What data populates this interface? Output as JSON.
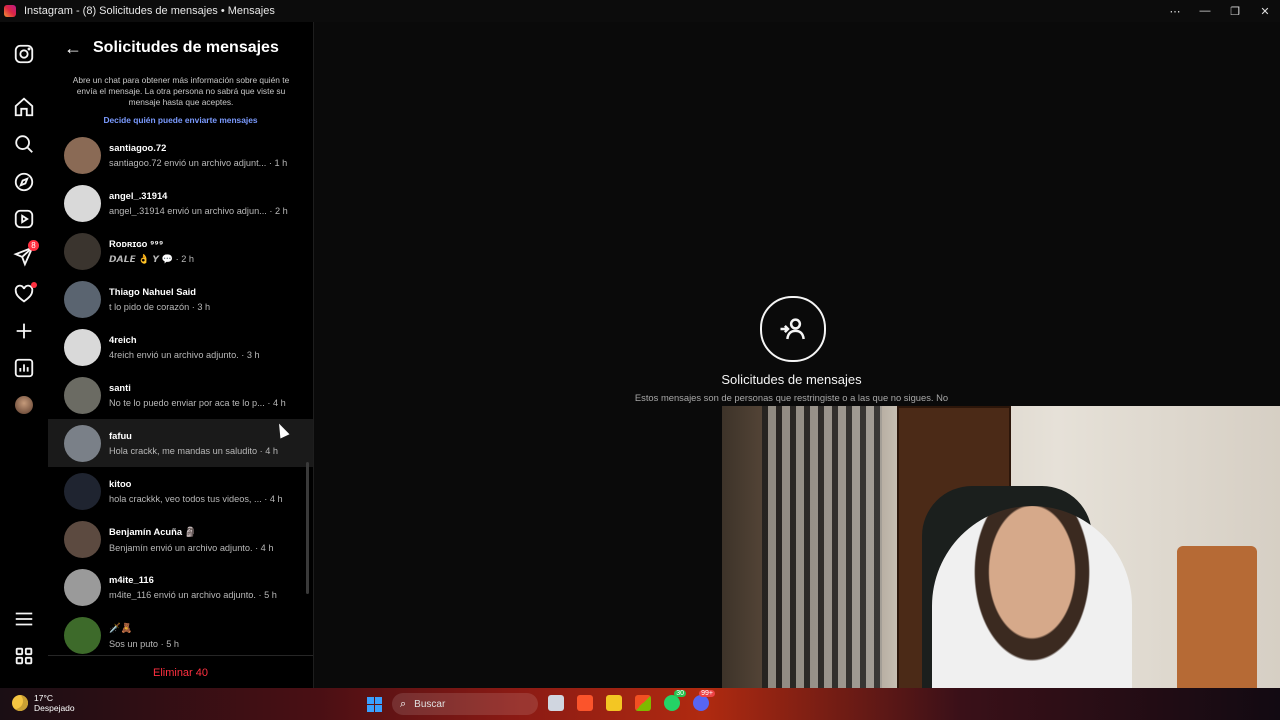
{
  "window": {
    "title": "Instagram - (8) Solicitudes de mensajes • Mensajes",
    "controls": [
      "⋯",
      "—",
      "❐",
      "✕"
    ]
  },
  "rail": {
    "notifications_badge": "8"
  },
  "panel": {
    "title": "Solicitudes de mensajes",
    "info": "Abre un chat para obtener más información sobre quién te envía el mensaje. La otra persona no sabrá que viste su mensaje hasta que aceptes.",
    "link": "Decide quién puede enviarte mensajes",
    "delete_label": "Eliminar 40"
  },
  "requests": [
    {
      "name": "santiagoo.72",
      "preview": "santiagoo.72 envió un archivo adjunt... · 1 h",
      "color": "#8a6a55"
    },
    {
      "name": "angel_.31914",
      "preview": "angel_.31914 envió un archivo adjun... · 2 h",
      "color": "#d9d9d9"
    },
    {
      "name": "Rᴏᴅʀɪɢᴏ  ⁹⁹⁹",
      "preview": "𝘿𝘼𝙇𝙀 👌 𝙔 💬 · 2 h",
      "color": "#3a342e"
    },
    {
      "name": "Thiago Nahuel Said",
      "preview": "t lo pido de corazón · 3 h",
      "color": "#5a6470"
    },
    {
      "name": "4reich",
      "preview": "4reich envió un archivo adjunto. · 3 h",
      "color": "#d9d9d9"
    },
    {
      "name": "santi",
      "preview": "No te lo puedo enviar por aca te lo p... · 4 h",
      "color": "#6b6b63"
    },
    {
      "name": "fafuu",
      "preview": "Hola crackk, me mandas un saludito · 4 h",
      "color": "#7a8088"
    },
    {
      "name": "kitoo",
      "preview": "hola crackkk, veo todos tus videos, ... · 4 h",
      "color": "#1f2430"
    },
    {
      "name": "Benjamín Acuña 🗿",
      "preview": "Benjamín envió un archivo adjunto. · 4 h",
      "color": "#5c4a40"
    },
    {
      "name": "m4ite_116",
      "preview": "m4ite_116 envió un archivo adjunto. · 5 h",
      "color": "#9a9a9a"
    },
    {
      "name": "🗡️🧸",
      "preview": "Sos un puto · 5 h",
      "color": "#3d6a2a"
    }
  ],
  "main": {
    "title": "Solicitudes de mensajes",
    "description": "Estos mensajes son de personas que restringiste o a las que no sigues. No sabrán que viste s"
  },
  "taskbar": {
    "temperature": "17°C",
    "condition": "Despejado",
    "search_label": "Buscar",
    "whatsapp_count": "30",
    "discord_count": "99+"
  }
}
